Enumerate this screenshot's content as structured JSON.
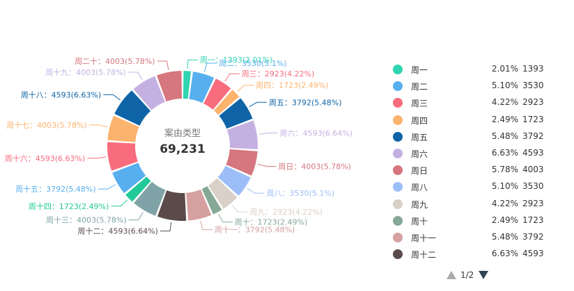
{
  "chart_data": {
    "type": "pie",
    "center_label": "案由类型",
    "center_value": "69,231",
    "slices": [
      {
        "name": "周一",
        "value": 1393,
        "percent": "2.01%",
        "label": "周一：1393(2.01%)",
        "color": "#2fd4b0"
      },
      {
        "name": "周二",
        "value": 3530,
        "percent": "5.1%",
        "label": "周二：3530(5.1%)",
        "color": "#58afee"
      },
      {
        "name": "周三",
        "value": 2923,
        "percent": "4.22%",
        "label": "周三：2923(4.22%)",
        "color": "#f86c7e"
      },
      {
        "name": "周四",
        "value": 1723,
        "percent": "2.49%",
        "label": "周四：1723(2.49%)",
        "color": "#fcb36e"
      },
      {
        "name": "周五",
        "value": 3792,
        "percent": "5.48%",
        "label": "周五：3792(5.48%)",
        "color": "#0e64a6"
      },
      {
        "name": "周六",
        "value": 4593,
        "percent": "6.64%",
        "label": "周六：4593(6.64%)",
        "color": "#c4b1e2"
      },
      {
        "name": "周日",
        "value": 4003,
        "percent": "5.78%",
        "label": "周日：4003(5.78%)",
        "color": "#d6767e"
      },
      {
        "name": "周八",
        "value": 3530,
        "percent": "5.1%",
        "label": "周八：3530(5.1%)",
        "color": "#9cbef8"
      },
      {
        "name": "周九",
        "value": 2923,
        "percent": "4.22%",
        "label": "周九：2923(4.22%)",
        "color": "#d9d0c7"
      },
      {
        "name": "周十",
        "value": 1723,
        "percent": "2.49%",
        "label": "周十：1723(2.49%)",
        "color": "#86a897"
      },
      {
        "name": "周十一",
        "value": 3792,
        "percent": "5.48%",
        "label": "周十一：3792(5.48%)",
        "color": "#d6a0a0"
      },
      {
        "name": "周十二",
        "value": 4593,
        "percent": "6.64%",
        "label": "周十二：4593(6.64%)",
        "color": "#5b4a4a"
      },
      {
        "name": "周十三",
        "value": 4003,
        "percent": "5.78%",
        "label": "周十三：4003(5.78%)",
        "color": "#7fa3a6"
      },
      {
        "name": "周十四",
        "value": 1723,
        "percent": "2.49%",
        "label": "周十四：1723(2.49%)",
        "color": "#20c997"
      },
      {
        "name": "周十五",
        "value": 3792,
        "percent": "5.48%",
        "label": "周十五：3792(5.48%)",
        "color": "#58afee"
      },
      {
        "name": "周十六",
        "value": 4593,
        "percent": "6.63%",
        "label": "周十六：4593(6.63%)",
        "color": "#f86c7e"
      },
      {
        "name": "周十七",
        "value": 4003,
        "percent": "5.78%",
        "label": "周十七：4003(5.78%)",
        "color": "#fcb36e"
      },
      {
        "name": "周十八",
        "value": 4593,
        "percent": "6.63%",
        "label": "周十八：4593(6.63%)",
        "color": "#0e64a6"
      },
      {
        "name": "周十九",
        "value": 4003,
        "percent": "5.78%",
        "label": "周十九：4003(5.78%)",
        "color": "#c4b1e2"
      },
      {
        "name": "周二十",
        "value": 4003,
        "percent": "5.78%",
        "label": "周二十：4003(5.78%)",
        "color": "#d6767e"
      }
    ],
    "legend": {
      "placement": "right",
      "items": [
        {
          "name": "周一",
          "percent": "2.01%",
          "value": "1393",
          "color": "#2fd4b0"
        },
        {
          "name": "周二",
          "percent": "5.10%",
          "value": "3530",
          "color": "#58afee"
        },
        {
          "name": "周三",
          "percent": "4.22%",
          "value": "2923",
          "color": "#f86c7e"
        },
        {
          "name": "周四",
          "percent": "2.49%",
          "value": "1723",
          "color": "#fcb36e"
        },
        {
          "name": "周五",
          "percent": "5.48%",
          "value": "3792",
          "color": "#0e64a6"
        },
        {
          "name": "周六",
          "percent": "6.63%",
          "value": "4593",
          "color": "#c4b1e2"
        },
        {
          "name": "周日",
          "percent": "5.78%",
          "value": "4003",
          "color": "#d6767e"
        },
        {
          "name": "周八",
          "percent": "5.10%",
          "value": "3530",
          "color": "#9cbef8"
        },
        {
          "name": "周九",
          "percent": "4.22%",
          "value": "2923",
          "color": "#d9d0c7"
        },
        {
          "name": "周十",
          "percent": "2.49%",
          "value": "1723",
          "color": "#86a897"
        },
        {
          "name": "周十一",
          "percent": "5.48%",
          "value": "3792",
          "color": "#d6a0a0"
        },
        {
          "name": "周十二",
          "percent": "6.63%",
          "value": "4593",
          "color": "#5b4a4a"
        }
      ],
      "page": "1/2"
    }
  }
}
